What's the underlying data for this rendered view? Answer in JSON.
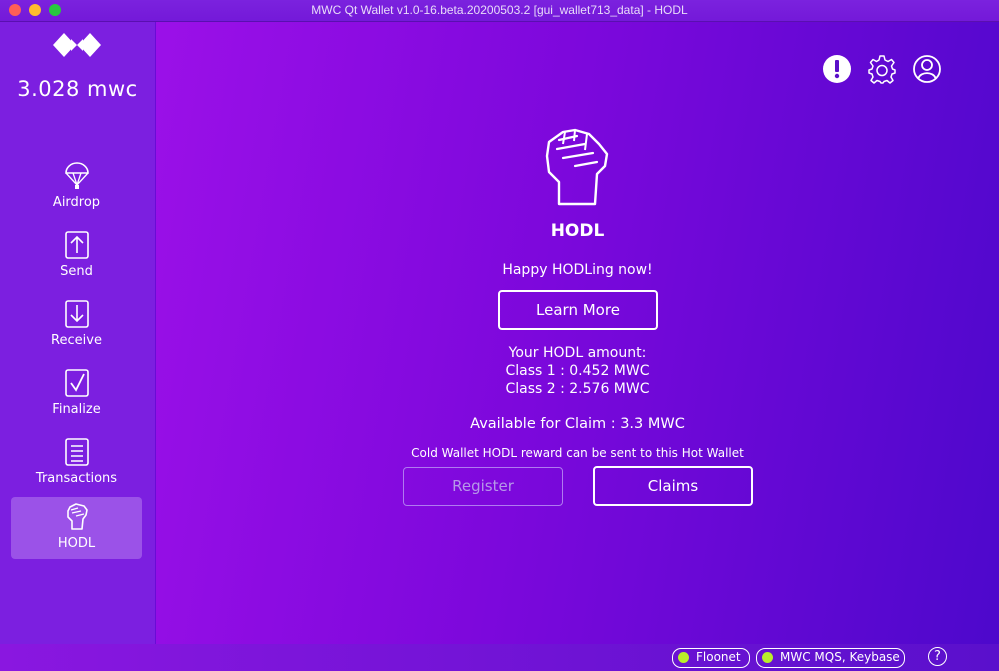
{
  "window": {
    "title": "MWC Qt Wallet v1.0-16.beta.20200503.2 [gui_wallet713_data] - HODL"
  },
  "sidebar": {
    "logo_icon": "mwc-logo-icon",
    "balance": "3.028 mwc",
    "items": [
      {
        "label": "Airdrop",
        "icon": "parachute-icon",
        "active": false
      },
      {
        "label": "Send",
        "icon": "send-arrow-up-icon",
        "active": false
      },
      {
        "label": "Receive",
        "icon": "receive-arrow-down-icon",
        "active": false
      },
      {
        "label": "Finalize",
        "icon": "checkmark-icon",
        "active": false
      },
      {
        "label": "Transactions",
        "icon": "document-icon",
        "active": false
      },
      {
        "label": "HODL",
        "icon": "fist-icon",
        "active": true
      }
    ]
  },
  "header": {
    "icons": [
      "notification-alert-icon",
      "settings-gear-icon",
      "account-icon"
    ]
  },
  "hodl": {
    "title": "HODL",
    "tagline": "Happy HODLing now!",
    "learn_more": "Learn More",
    "amount_header": "Your HODL amount:",
    "class1": "Class 1 : 0.452 MWC",
    "class2": "Class 2 : 2.576 MWC",
    "available": "Available for Claim : 3.3 MWC",
    "cold_wallet_note": "Cold Wallet HODL reward can be sent to this Hot Wallet",
    "register": "Register",
    "claims": "Claims"
  },
  "status": {
    "network": "Floonet",
    "listeners": "MWC MQS, Keybase",
    "help": "?",
    "indicator_color": "#b9ef2a"
  },
  "colors": {
    "sidebar_bg": "#7c1fe0",
    "active_item_bg": "#9b52e8",
    "main_gradient_start": "#9b10e8",
    "main_gradient_end": "#4d08cc"
  }
}
